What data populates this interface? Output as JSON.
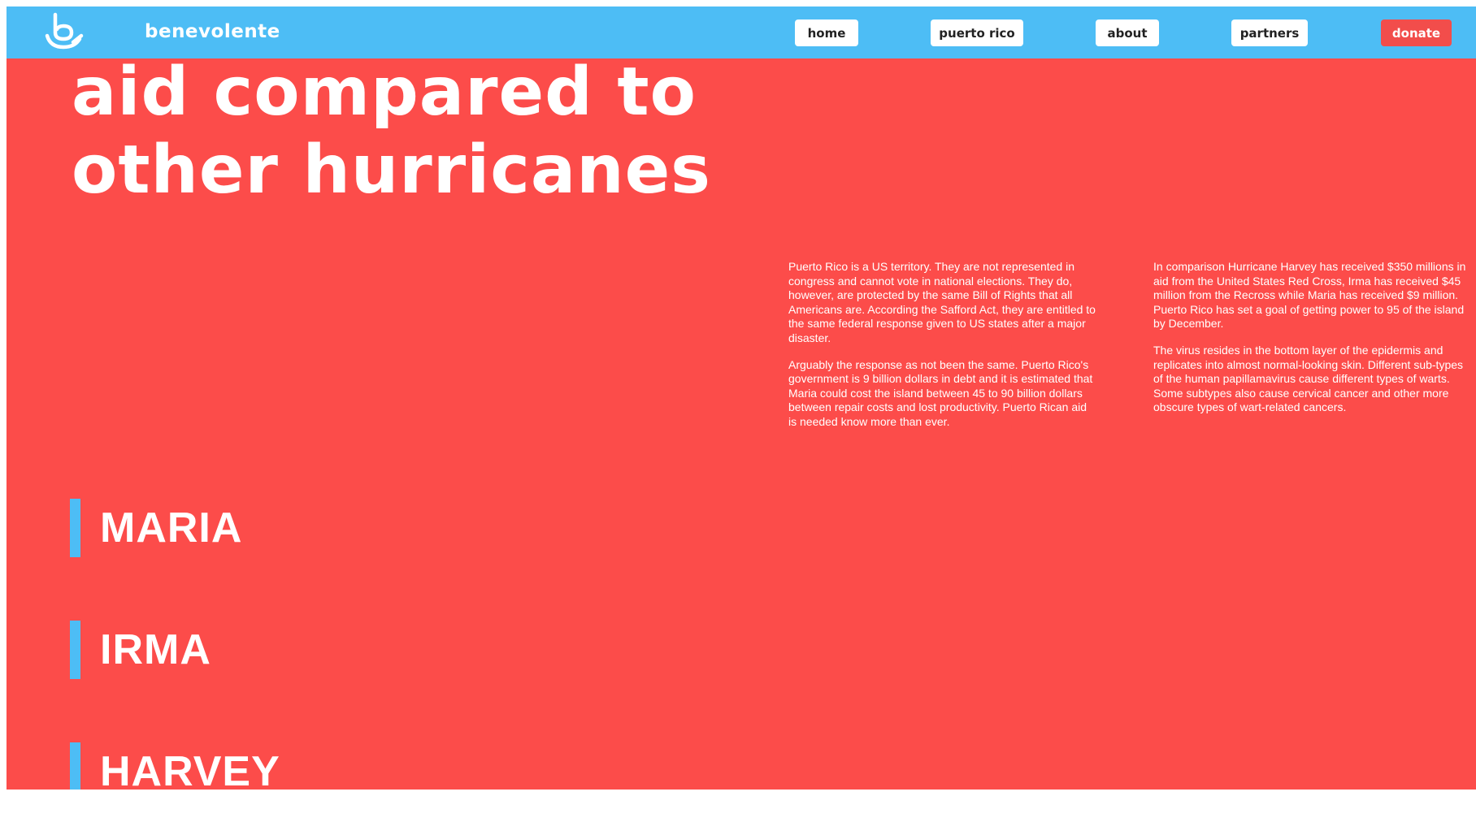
{
  "colors": {
    "nav_bg": "#4dbdf5",
    "page_bg": "#fc4c4a",
    "donate_bg": "#f24d4b",
    "accent_bar": "#4dbdf5",
    "text": "#ffffff"
  },
  "header": {
    "brand": "benevolente",
    "logo_icon": "hand-holding-b-logo-icon",
    "nav": {
      "home": "home",
      "puerto_rico": "puerto rico",
      "about": "about",
      "partners": "partners",
      "donate": "donate"
    }
  },
  "main": {
    "title_line1": "aid compared to",
    "title_line2": "other hurricanes",
    "left_col": {
      "p1": "Puerto Rico is a US territory. They are not represented in congress and cannot vote in national elections. They do, however, are protected by the same Bill of Rights that all Americans are. According the Safford Act, they are entitled to the same federal response given to US states after a major disaster.",
      "p2": "Arguably the response as not been the same. Puerto Rico's government is 9 billion dollars in debt and it is estimated that Maria could cost the island between 45 to 90 billion dollars between repair costs and lost productivity. Puerto Rican aid is needed know more than ever."
    },
    "right_col": {
      "p1": "In comparison Hurricane Harvey has received $350 millions in aid from the United States Red Cross, Irma has received $45 million from the Recross while Maria has received $9 million. Puerto Rico has set a goal of getting power to 95 of the island by December.",
      "p2": "The virus resides in the bottom layer of the epidermis and replicates into almost normal-looking skin. Different sub-types of the human papillamavirus cause different types of warts. Some subtypes also cause cervical cancer and other more obscure types of wart-related cancers."
    },
    "storms": {
      "maria": "MARIA",
      "irma": "IRMA",
      "harvey": "HARVEY"
    }
  }
}
